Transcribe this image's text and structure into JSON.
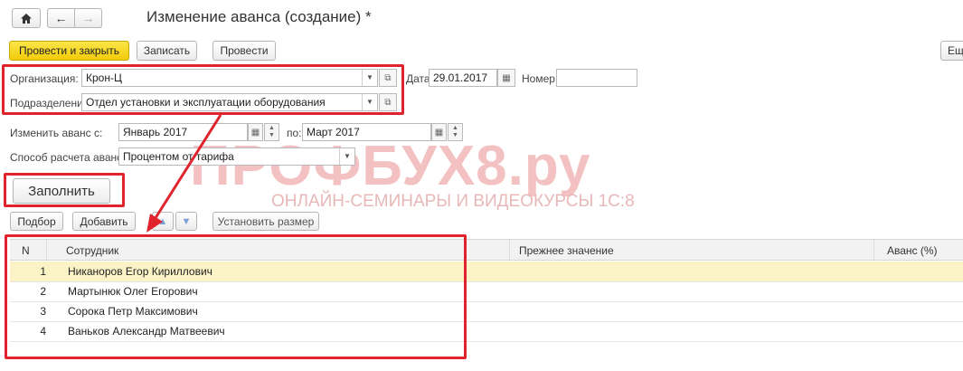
{
  "title": "Изменение аванса (создание) *",
  "toolbar": {
    "post_close": "Провести и закрыть",
    "save": "Записать",
    "post": "Провести",
    "more": "Ещ"
  },
  "org": {
    "label": "Организация:",
    "value": "Крон-Ц"
  },
  "date": {
    "label": "Дата:",
    "value": "29.01.2017"
  },
  "number": {
    "label": "Номер:",
    "value": ""
  },
  "dept": {
    "label": "Подразделение:",
    "value": "Отдел установки и эксплуатации оборудования"
  },
  "change": {
    "label": "Изменить аванс с:",
    "from": "Январь 2017",
    "to_label": "по:",
    "to": "Март 2017"
  },
  "method": {
    "label": "Способ расчета аванса:",
    "value": "Процентом от тарифа"
  },
  "fill_button": "Заполнить",
  "table_toolbar": {
    "pick": "Подбор",
    "add": "Добавить",
    "set_size": "Установить размер"
  },
  "watermark": {
    "brand": "ПРОФБУХ8.ру",
    "tagline": "ОНЛАЙН-СЕМИНАРЫ И ВИДЕОКУРСЫ 1С:8"
  },
  "table": {
    "columns": [
      "N",
      "Сотрудник",
      "Прежнее значение",
      "Аванс (%)"
    ],
    "rows": [
      {
        "n": "1",
        "employee": "Никаноров Егор Кириллович",
        "prev": "",
        "advance": ""
      },
      {
        "n": "2",
        "employee": "Мартынюк Олег Егорович",
        "prev": "",
        "advance": ""
      },
      {
        "n": "3",
        "employee": "Сорока Петр Максимович",
        "prev": "",
        "advance": ""
      },
      {
        "n": "4",
        "employee": "Ваньков Александр Матвеевич",
        "prev": "",
        "advance": ""
      }
    ]
  },
  "colors": {
    "accent_yellow": "#f6d60a",
    "highlight_red": "#e0232c",
    "row_selected": "#fbf3c6"
  }
}
